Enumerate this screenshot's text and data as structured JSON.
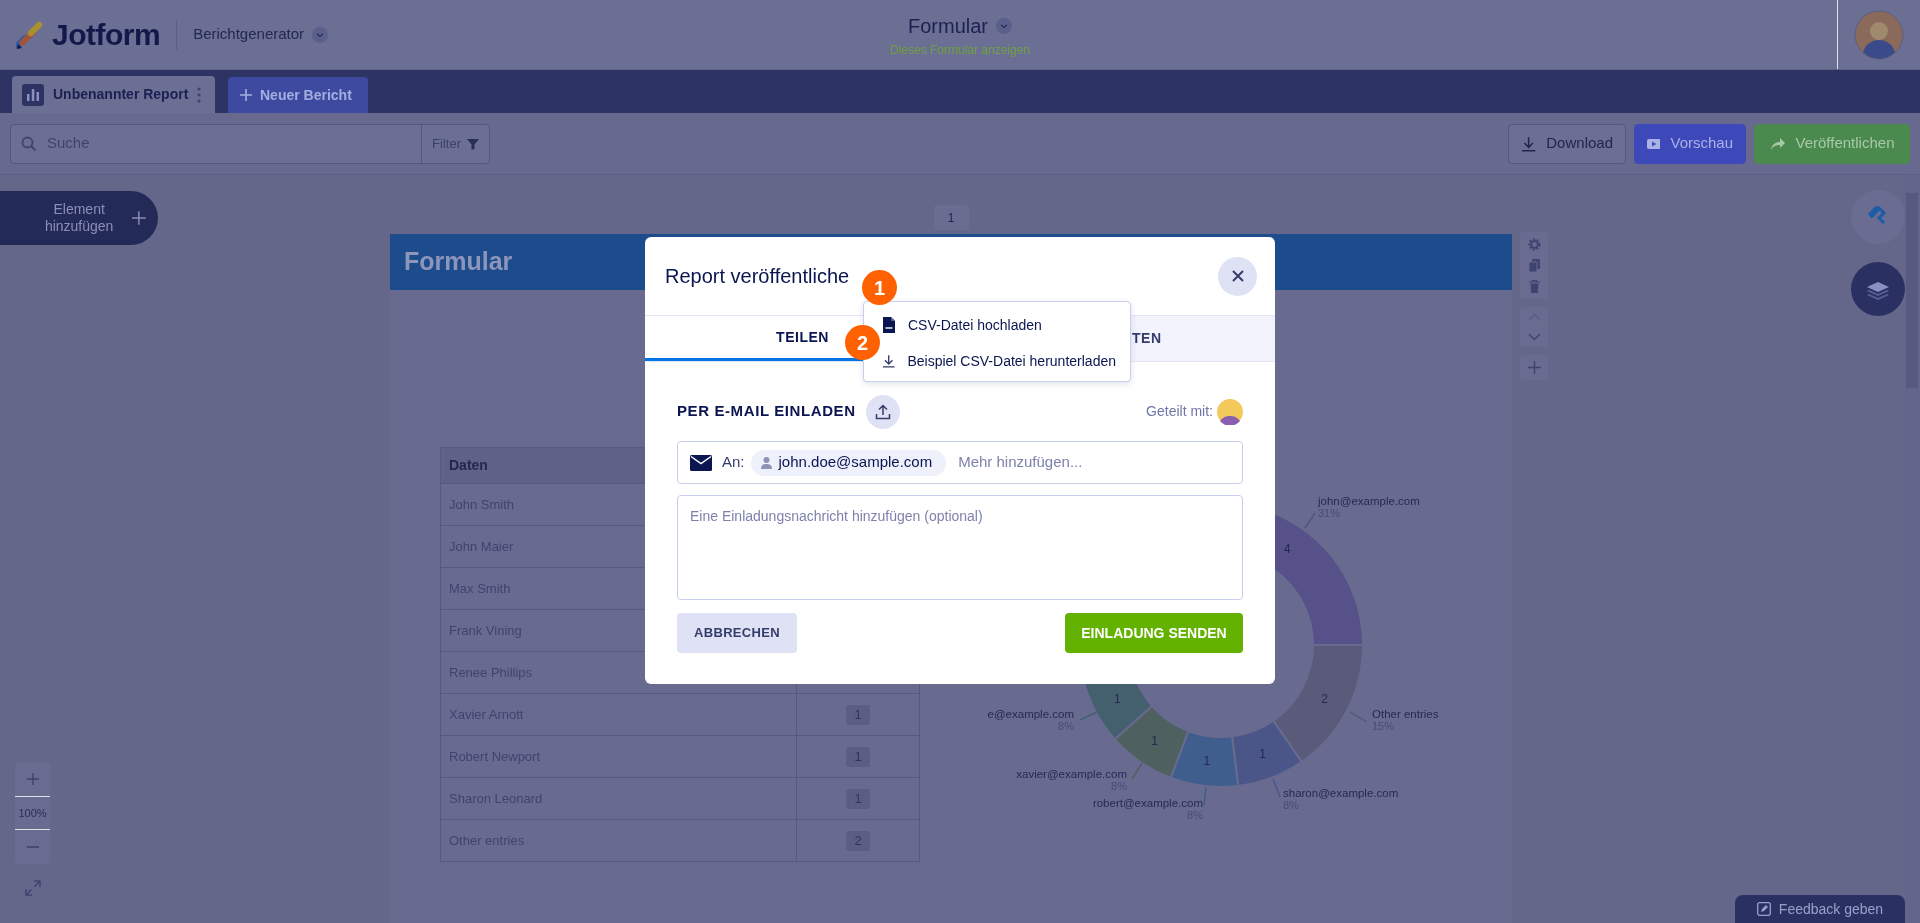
{
  "header": {
    "logo": "Jotform",
    "app_name": "Berichtgenerator",
    "form_title": "Formular",
    "form_link": "Dieses Formular anzeigen"
  },
  "report_tabs": [
    {
      "label": "Unbenannter Report",
      "selected": true
    }
  ],
  "new_report": "Neuer Bericht",
  "toolbar": {
    "search_placeholder": "Suche",
    "filter": "Filter",
    "buttons": [
      {
        "label": "Download",
        "kind": "download"
      },
      {
        "label": "Vorschau",
        "kind": "preview"
      },
      {
        "label": "Veröffentlichen",
        "kind": "publish"
      }
    ]
  },
  "add_element": "Element hinzufügen",
  "page_number": "1",
  "zoom_level": "100%",
  "feedback": "Feedback geben",
  "report": {
    "title": "Formular",
    "table": {
      "columns": [
        "Daten"
      ],
      "rows": [
        {
          "name": "John Smith"
        },
        {
          "name": "John Maier"
        },
        {
          "name": "Max Smith"
        },
        {
          "name": "Frank Vining"
        },
        {
          "name": "Renee Phillips"
        },
        {
          "name": "Xavier Arnott",
          "count": "1"
        },
        {
          "name": "Robert Newport",
          "count": "1"
        },
        {
          "name": "Sharon Leonard",
          "count": "1"
        },
        {
          "name": "Other entries",
          "count": "2"
        }
      ]
    },
    "chart_data": {
      "type": "donut",
      "categories": [
        "john@example.com",
        "Other entries",
        "sharon@example.com",
        "robert@example.com",
        "xavier@example.com",
        "e@example.com"
      ],
      "values": [
        4,
        2,
        1,
        1,
        1,
        1
      ],
      "data_labels": true
    },
    "slices": [
      {
        "percent": "31%",
        "color": "#57518a"
      },
      {
        "percent": "15%",
        "color": "#5a5b7b"
      },
      {
        "percent": "8%",
        "color": "#4a5588"
      },
      {
        "percent": "8%",
        "color": "#3f5e8e"
      },
      {
        "percent": "8%",
        "color": "#4f6060"
      },
      {
        "percent": "8%",
        "color": "#44606f"
      }
    ]
  },
  "modal": {
    "title": "Report veröffentliche",
    "tabs": [
      {
        "label": "TEILEN",
        "selected": true
      },
      {
        "label": "TEN",
        "selected": false
      }
    ],
    "menu": [
      {
        "label": "CSV-Datei hochladen",
        "kind": "csv"
      },
      {
        "label": "Beispiel CSV-Datei herunterladen",
        "kind": "download"
      }
    ],
    "steps": [
      "1",
      "2"
    ],
    "section_title": "PER E-MAIL EINLADEN",
    "shared_with": "Geteilt mit:",
    "to_label": "An:",
    "recipients": [
      "john.doe@sample.com"
    ],
    "recipient_placeholder": "Mehr hinzufügen...",
    "message_placeholder": "Eine Einladungsnachricht hinzufügen (optional)",
    "cancel": "ABBRECHEN",
    "send": "EINLADUNG SENDEN"
  }
}
